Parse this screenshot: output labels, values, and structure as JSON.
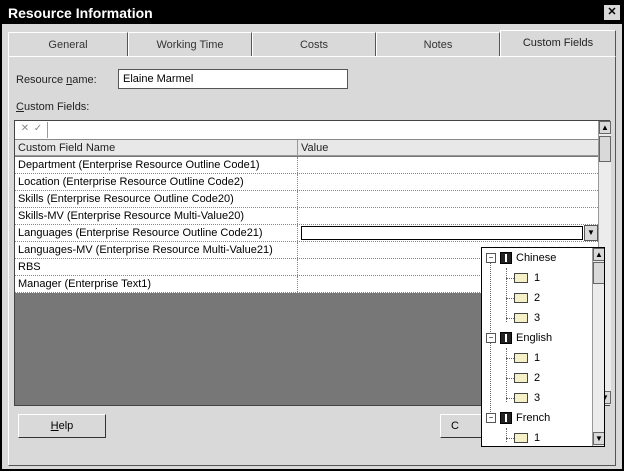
{
  "window": {
    "title": "Resource Information",
    "close_glyph": "✕"
  },
  "tabs": [
    "General",
    "Working Time",
    "Costs",
    "Notes",
    "Custom Fields"
  ],
  "active_tab": "Custom Fields",
  "resource_name": {
    "label_pre": "Resource ",
    "label_u": "n",
    "label_post": "ame:",
    "value": "Elaine Marmel"
  },
  "custom_fields": {
    "label_u": "C",
    "label_post": "ustom Fields:"
  },
  "grid": {
    "headers": [
      "Custom Field Name",
      "Value"
    ],
    "rows": [
      "Department (Enterprise Resource Outline Code1)",
      "Location (Enterprise Resource Outline Code2)",
      "Skills (Enterprise Resource Outline Code20)",
      "Skills-MV (Enterprise Resource Multi-Value20)",
      "Languages (Enterprise Resource Outline Code21)",
      "Languages-MV (Enterprise Resource Multi-Value21)",
      "RBS",
      "Manager (Enterprise Text1)"
    ],
    "active_row": 4
  },
  "dropdown_tree": [
    {
      "label": "Chinese",
      "children": [
        "1",
        "2",
        "3"
      ]
    },
    {
      "label": "English",
      "children": [
        "1",
        "2",
        "3"
      ]
    },
    {
      "label": "French",
      "children": [
        "1"
      ]
    }
  ],
  "buttons": {
    "help_u": "H",
    "help_rest": "elp",
    "ok_partial": "C"
  },
  "icons": {
    "cancel": "✕",
    "accept": "✓",
    "dropdown": "▼",
    "up": "▲",
    "down": "▼"
  }
}
